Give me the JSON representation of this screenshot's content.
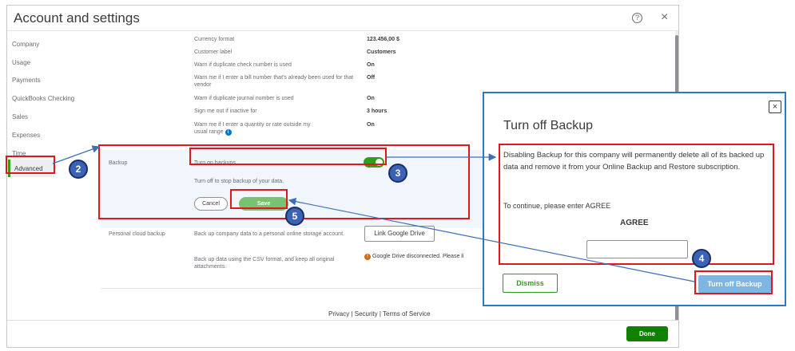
{
  "window": {
    "title": "Account and settings",
    "help_glyph": "?",
    "close_glyph": "×"
  },
  "sidebar": {
    "items": [
      {
        "label": "Company"
      },
      {
        "label": "Usage"
      },
      {
        "label": "Payments"
      },
      {
        "label": "QuickBooks Checking"
      },
      {
        "label": "Sales"
      },
      {
        "label": "Expenses"
      },
      {
        "label": "Time"
      },
      {
        "label": "Advanced",
        "active": true
      }
    ]
  },
  "settings": {
    "rows": [
      {
        "label": "Currency format",
        "value": "123.456,00 $"
      },
      {
        "label": "Customer label",
        "value": "Customers"
      },
      {
        "label": "Warn if duplicate check number is used",
        "value": "On"
      },
      {
        "label": "Warn me if I enter a bill number that's already been used for that vendor",
        "value": "Off"
      },
      {
        "label": "Warn if duplicate journal number is used",
        "value": "On"
      },
      {
        "label": "Sign me out if inactive for",
        "value": "3 hours"
      },
      {
        "label": "Warn me if I enter a quantity or rate outside my usual range",
        "value": "On"
      }
    ],
    "info_glyph": "i"
  },
  "backup": {
    "section_label": "Backup",
    "toggle_label": "Turn on backups",
    "toggle_state": "on",
    "helper": "Turn off to stop backup of your data.",
    "cancel_label": "Cancel",
    "save_label": "Save"
  },
  "cloud_backup": {
    "section_label": "Personal cloud backup",
    "desc1": "Back up company data to a personal online storage account.",
    "desc2": "Back up data using the CSV format, and keep all original attachments.",
    "link_button": "Link Google Drive",
    "status_text": "Google Drive disconnected. Please li",
    "warn_glyph": "!"
  },
  "footer": {
    "links": "Privacy  |  Security  |  Terms of Service"
  },
  "done_label": "Done",
  "modal": {
    "close_glyph": "×",
    "title": "Turn off Backup",
    "message": "Disabling Backup for this company will permanently delete all of its backed up data and remove it from your Online Backup and Restore subscription.",
    "prompt": "To continue, please enter AGREE",
    "agree_word": "AGREE",
    "input_value": "",
    "dismiss_label": "Dismiss",
    "confirm_label": "Turn off Backup"
  },
  "annotations": {
    "steps": [
      "2",
      "3",
      "4",
      "5"
    ],
    "highlight_color": "#e0171f",
    "badge_color": "#3b62b4",
    "arrow_color": "#3b6fb6"
  },
  "colors": {
    "brand_green": "#2ca01c",
    "done_green": "#108000",
    "modal_border": "#2a79c4"
  }
}
